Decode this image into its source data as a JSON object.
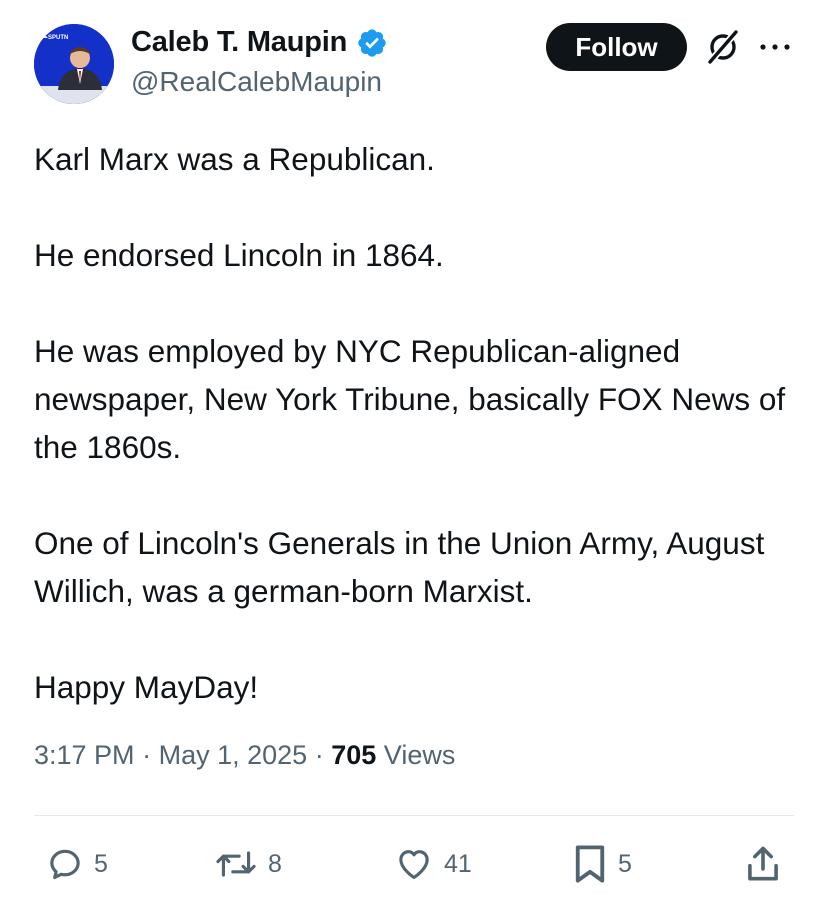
{
  "header": {
    "display_name": "Caleb T. Maupin",
    "handle": "@RealCalebMaupin",
    "follow_label": "Follow",
    "avatar_text": "SPUTN"
  },
  "tweet": {
    "lines": [
      "Karl Marx was a Republican.",
      "",
      "He endorsed Lincoln in 1864.",
      "",
      "He was employed by NYC Republican-aligned newspaper, New York Tribune, basically FOX News of the 1860s.",
      "",
      "One of Lincoln's Generals in the Union Army, August Willich, was a german-born Marxist.",
      "",
      "Happy MayDay!"
    ],
    "time": "3:17 PM",
    "separator": "·",
    "date": "May 1, 2025",
    "views_count": "705",
    "views_label": "Views"
  },
  "actions": {
    "replies": "5",
    "reposts": "8",
    "likes": "41",
    "bookmarks": "5"
  },
  "icons": [
    "verified-badge-icon",
    "grok-icon",
    "more-icon",
    "reply-icon",
    "repost-icon",
    "like-icon",
    "bookmark-icon",
    "share-icon"
  ],
  "colors": {
    "text": "#0f1419",
    "secondary": "#536471",
    "verified": "#1d9bf0",
    "follow_bg": "#0f1419",
    "avatar_bg": "#1330c8"
  }
}
